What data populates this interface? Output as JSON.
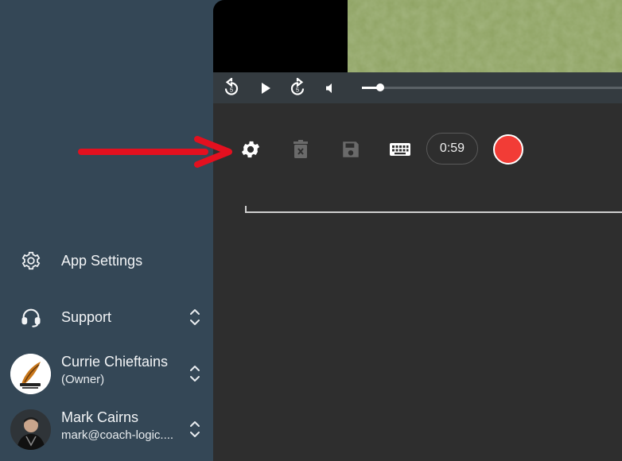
{
  "sidebar": {
    "items": [
      {
        "label": "App Settings",
        "icon": "gear-icon"
      },
      {
        "label": "Support",
        "icon": "headset-icon"
      }
    ],
    "accounts": [
      {
        "name": "Currie Chieftains",
        "sub": "(Owner)",
        "avatar": "team-logo-avatar"
      },
      {
        "name": "Mark Cairns",
        "sub": "mark@coach-logic....",
        "avatar": "user-photo-avatar"
      }
    ]
  },
  "player": {
    "controls": [
      "rewind-5-icon",
      "play-icon",
      "forward-5-icon",
      "volume-icon"
    ],
    "rewind_label": "5",
    "forward_label": "5",
    "progress": 0.07
  },
  "toolbar": {
    "timer": "0:59",
    "tools": [
      "settings-gear-icon",
      "delete-icon",
      "save-icon",
      "keyboard-icon",
      "record-button"
    ]
  },
  "colors": {
    "sidebar_bg": "#344756",
    "main_bg": "#2e2e2e",
    "record": "#f23c36",
    "annotation_arrow": "#e3101f"
  }
}
